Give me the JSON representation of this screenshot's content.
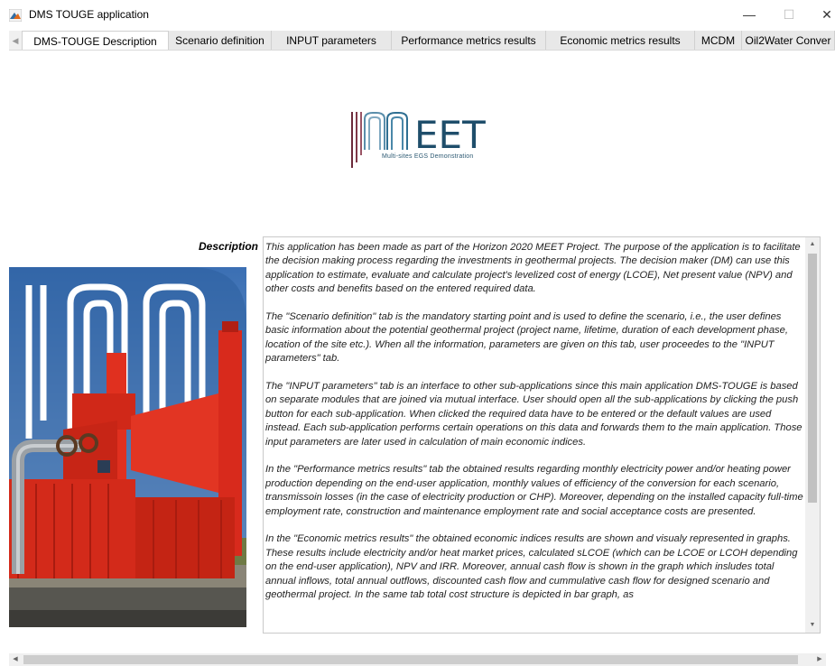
{
  "window": {
    "title": "DMS TOUGE application",
    "controls": {
      "minimize": "—",
      "maximize": "☐",
      "close": "✕"
    }
  },
  "tabs": [
    {
      "label": "DMS-TOUGE Description",
      "active": true
    },
    {
      "label": "Scenario definition",
      "active": false
    },
    {
      "label": "INPUT parameters",
      "active": false
    },
    {
      "label": "Performance metrics results",
      "active": false
    },
    {
      "label": "Economic metrics results",
      "active": false
    },
    {
      "label": "MCDM",
      "active": false
    },
    {
      "label": "Oil2Water Conver",
      "active": false
    }
  ],
  "logo": {
    "name": "MEET",
    "subtitle": "Multi-sites EGS Demonstration",
    "colors": {
      "stripe_dark": "#6b2a3a",
      "stripe_blue": "#4a87a8",
      "text": "#1f4e6b"
    }
  },
  "description": {
    "label": "Description",
    "paragraphs": [
      "This application has been made as part of the Horizon 2020 MEET Project. The purpose of the application is to facilitate the decision making process regarding the investments in geothermal projects. The decision maker (DM) can use this application to estimate, evaluate and calculate project's levelized cost of energy (LCOE), Net present value (NPV) and other costs and benefits based on the entered required data.",
      "The \"Scenario definition\" tab is the mandatory starting point and is used to define the scenario, i.e., the user defines basic information about the potential geothermal project (project name, lifetime, duration of each development phase, location of the site etc.). When all the information, parameters are given on this tab, user proceedes to the \"INPUT parameters\" tab.",
      "The \"INPUT parameters\" tab is an interface to other sub-applications since this main application DMS-TOUGE is based on separate modules that are joined via mutual interface. User should open all the sub-applications by clicking the push button for each sub-application. When clicked  the required data have to be entered or the default values are used instead. Each sub-application performs certain operations on this data and forwards them to the main application.  Those input parameters are  later used in calculation of main economic indices.",
      "In the \"Performance metrics results\"  tab the obtained results regarding monthly electricity power and/or heating power production depending on the end-user application, monthly values of efficiency of the conversion for each scenario, transmissoin losses (in the case of electricity production or CHP). Moreover, depending on the installed capacity  full-time employment rate, construction and maintenance employment rate and social acceptance costs are presented.",
      "In the \"Economic metrics results\" the obtained economic indices results are shown and visualy represented in graphs. These results include electricity and/or heat market prices, calculated sLCOE (which can be LCOE or LCOH depending on the end-user application), NPV and IRR. Moreover, annual cash flow is shown in the graph which insludes total annual inflows, total annual outflows, discounted cash flow and cummulative cash flow for designed scenario and geothermal project. In the same tab total cost structure is depicted in bar graph, as"
    ]
  },
  "scrollbars": {
    "up_arrow": "▲",
    "down_arrow": "▼",
    "left_arrow": "◀",
    "right_arrow": "▶",
    "vertical_position": 0.3,
    "horizontal_position": 0.0
  }
}
